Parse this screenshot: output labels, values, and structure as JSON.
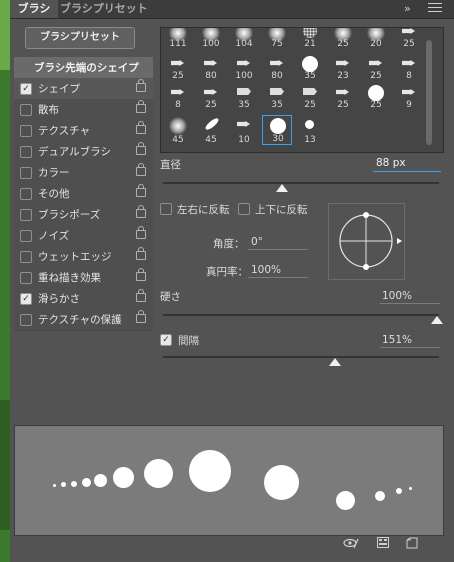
{
  "tabs": {
    "brush": "ブラシ",
    "brush_presets": "ブラシプリセット"
  },
  "preset_button": "ブラシプリセット",
  "settings_list": [
    {
      "label": "ブラシ先端のシェイプ",
      "type": "header"
    },
    {
      "label": "シェイプ",
      "checked": "✓"
    },
    {
      "label": "散布",
      "checked": ""
    },
    {
      "label": "テクスチャ",
      "checked": ""
    },
    {
      "label": "デュアルブラシ",
      "checked": ""
    },
    {
      "label": "カラー",
      "checked": ""
    },
    {
      "label": "その他",
      "checked": ""
    },
    {
      "label": "ブラシポーズ",
      "checked": ""
    },
    {
      "label": "ノイズ",
      "checked": ""
    },
    {
      "label": "ウェットエッジ",
      "checked": ""
    },
    {
      "label": "重ね描き効果",
      "checked": ""
    },
    {
      "label": "滑らかさ",
      "checked": "✓"
    },
    {
      "label": "テクスチャの保護",
      "checked": ""
    }
  ],
  "brush_tips": {
    "row1": [
      "111",
      "100",
      "104",
      "75",
      "21",
      "25",
      "20",
      "25"
    ],
    "row2": [
      "25",
      "80",
      "100",
      "80",
      "35",
      "23",
      "25",
      "8"
    ],
    "row3": [
      "8",
      "25",
      "35",
      "35",
      "25",
      "25",
      "25",
      "9"
    ],
    "row4": [
      "45",
      "45",
      "10",
      "30",
      "13"
    ]
  },
  "size": {
    "label": "直径",
    "value": "88 px"
  },
  "flip_x": "左右に反転",
  "flip_y": "上下に反転",
  "angle": {
    "label": "角度：",
    "value": "0°"
  },
  "roundness": {
    "label": "真円率：",
    "value": "100%"
  },
  "hardness": {
    "label": "硬さ",
    "value": "100%"
  },
  "spacing": {
    "label": "間隔",
    "value": "151%",
    "checked": "✓"
  },
  "colors": {
    "panel_bg": "#535353",
    "tab_bg": "#3c3c3c",
    "accent": "#3aa0e8",
    "preview_bg": "#7b7b7b"
  }
}
